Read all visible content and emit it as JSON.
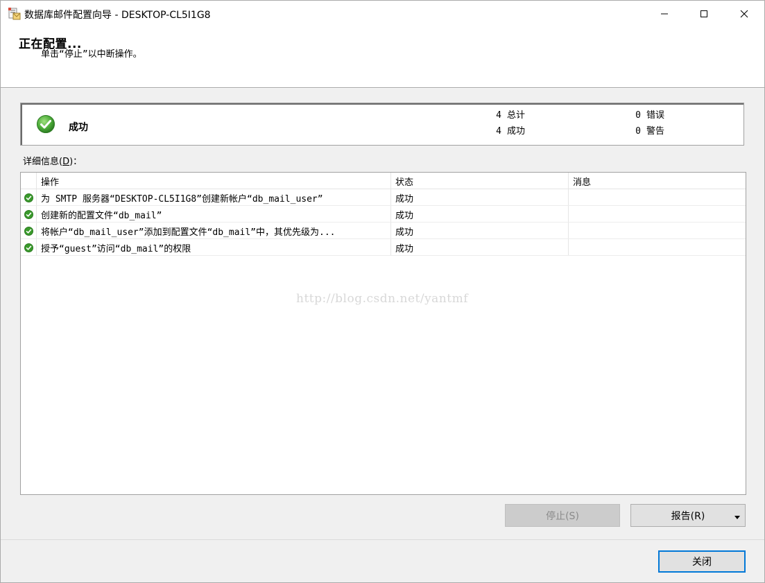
{
  "window": {
    "title": "数据库邮件配置向导 - DESKTOP-CL5I1G8",
    "minimize_icon": "minimize-icon",
    "maximize_icon": "maximize-icon",
    "close_icon": "close-icon"
  },
  "header": {
    "title": "正在配置...",
    "subtitle": "单击“停止”以中断操作。"
  },
  "summary": {
    "status": "成功",
    "status_icon": "success-check-icon",
    "total_count": "4",
    "total_label": "总计",
    "success_count": "4",
    "success_label": "成功",
    "error_count": "0",
    "error_label": "错误",
    "warning_count": "0",
    "warning_label": "警告"
  },
  "details": {
    "label_prefix": "详细信息(",
    "label_key": "D",
    "label_suffix": ")：",
    "columns": [
      "操作",
      "状态",
      "消息"
    ],
    "rows": [
      {
        "action": "为 SMTP 服务器“DESKTOP-CL5I1G8”创建新帐户“db_mail_user”",
        "status": "成功",
        "message": ""
      },
      {
        "action": "创建新的配置文件“db_mail”",
        "status": "成功",
        "message": ""
      },
      {
        "action": "将帐户“db_mail_user”添加到配置文件“db_mail”中，其优先级为...",
        "status": "成功",
        "message": ""
      },
      {
        "action": "授予“guest”访问“db_mail”的权限",
        "status": "成功",
        "message": ""
      }
    ],
    "watermark": "http://blog.csdn.net/yantmf"
  },
  "buttons": {
    "stop": "停止(S)",
    "report": "报告(R)",
    "close": "关闭"
  },
  "colors": {
    "success_green": "#3a9a2c",
    "accent_blue": "#0078d7",
    "panel_bg": "#f0f0f0"
  }
}
